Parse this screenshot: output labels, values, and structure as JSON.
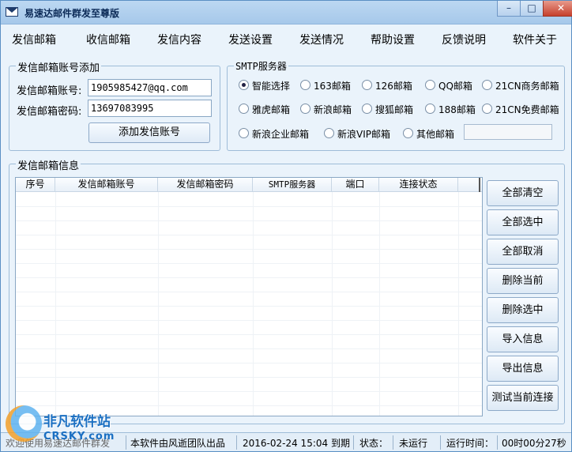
{
  "window": {
    "title": "易速达邮件群发至尊版",
    "minimize": "–",
    "maximize": "□",
    "close": "✕"
  },
  "menu": [
    "发信邮箱",
    "收信邮箱",
    "发信内容",
    "发送设置",
    "发送情况",
    "帮助设置",
    "反馈说明",
    "软件关于"
  ],
  "account": {
    "legend": "发信邮箱账号添加",
    "email_label": "发信邮箱账号:",
    "email_value": "1905985427@qq.com",
    "password_label": "发信邮箱密码:",
    "password_value": "13697083995",
    "add_button": "添加发信账号"
  },
  "smtp": {
    "legend": "SMTP服务器",
    "options": [
      "智能选择",
      "163邮箱",
      "126邮箱",
      "QQ邮箱",
      "21CN商务邮箱",
      "雅虎邮箱",
      "新浪邮箱",
      "搜狐邮箱",
      "188邮箱",
      "21CN免费邮箱",
      "新浪企业邮箱",
      "新浪VIP邮箱",
      "其他邮箱"
    ],
    "selected": "智能选择",
    "other_value": ""
  },
  "info": {
    "legend": "发信邮箱信息",
    "columns": [
      "序号",
      "发信邮箱账号",
      "发信邮箱密码",
      "SMTP服务器",
      "端口",
      "连接状态"
    ],
    "rows": []
  },
  "side_buttons": [
    "全部清空",
    "全部选中",
    "全部取消",
    "删除当前",
    "删除选中",
    "导入信息",
    "导出信息",
    "测试当前连接"
  ],
  "status": {
    "welcome": "欢迎使用易速达邮件群发",
    "author": "本软件由风逝团队出品",
    "expire": "2016-02-24 15:04 到期",
    "state_label": "状态：",
    "state_value": "未运行",
    "runtime_label": "运行时间：",
    "runtime_value": "00时00分27秒"
  },
  "watermark": {
    "cn": "非凡软件站",
    "en": "CRSKY.com"
  }
}
